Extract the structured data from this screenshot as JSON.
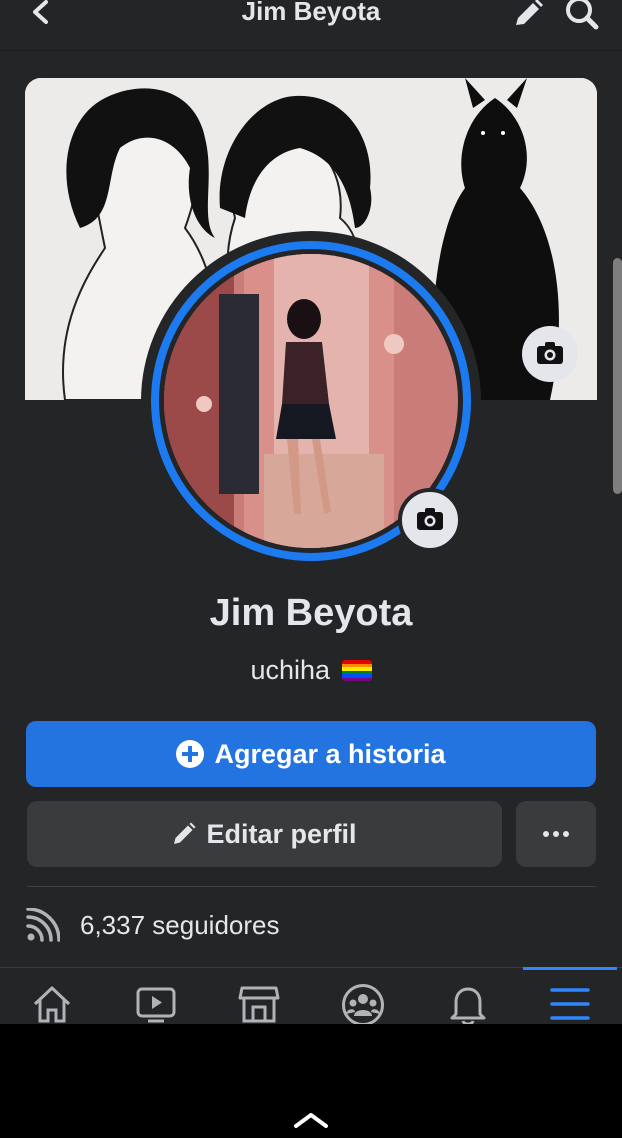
{
  "topbar": {
    "title": "Jim Beyota",
    "back_icon": "chevron-left-icon",
    "edit_icon": "pencil-icon",
    "search_icon": "search-icon"
  },
  "profile": {
    "name": "Jim Beyota",
    "bio": "uchiha",
    "bio_emoji": "rainbow-flag-icon"
  },
  "actions": {
    "add_story_label": "Agregar a historia",
    "edit_profile_label": "Editar perfil",
    "more_icon": "ellipsis-icon"
  },
  "stats": {
    "followers_text": "6,337 seguidores"
  },
  "tabbar": {
    "tabs": [
      "home-icon",
      "video-icon",
      "marketplace-icon",
      "groups-icon",
      "notifications-icon",
      "menu-icon"
    ],
    "active_tab": "menu-icon"
  },
  "colors": {
    "background": "#242526",
    "primary_blue": "#2374e1",
    "secondary_button": "#3a3b3c",
    "text": "#e4e6eb"
  }
}
